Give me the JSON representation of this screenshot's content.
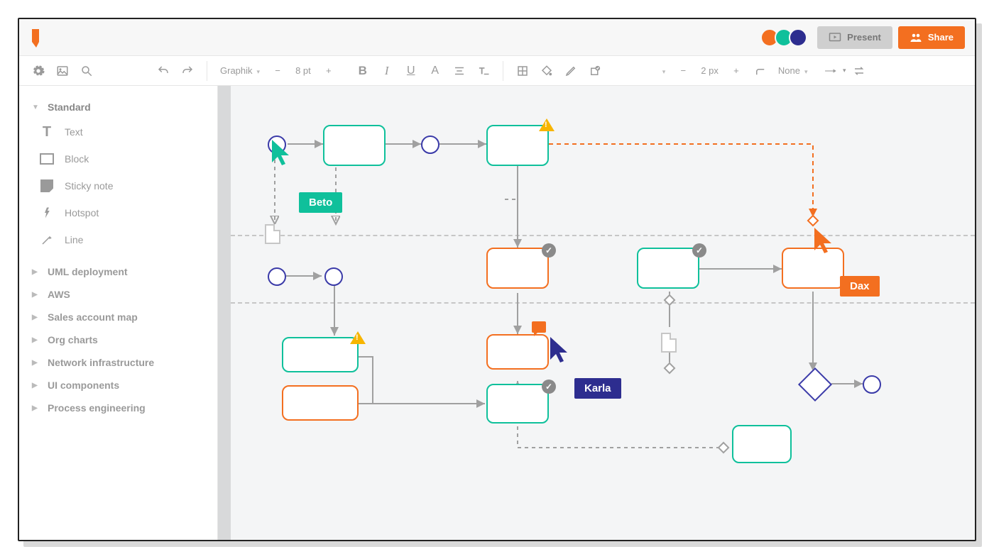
{
  "header": {
    "present_label": "Present",
    "share_label": "Share",
    "presence_colors": [
      "#f36f20",
      "#0fc09b",
      "#2d2d8f"
    ]
  },
  "toolbar": {
    "font_family": "Graphik",
    "font_size": "8 pt",
    "stroke_width": "2 px",
    "line_style": "None"
  },
  "sidebar": {
    "groups": [
      {
        "label": "Standard",
        "expanded": true,
        "items": [
          {
            "label": "Text",
            "icon": "text"
          },
          {
            "label": "Block",
            "icon": "block"
          },
          {
            "label": "Sticky note",
            "icon": "sticky"
          },
          {
            "label": "Hotspot",
            "icon": "hotspot"
          },
          {
            "label": "Line",
            "icon": "line"
          }
        ]
      },
      {
        "label": "UML deployment",
        "expanded": false
      },
      {
        "label": "AWS",
        "expanded": false
      },
      {
        "label": "Sales account map",
        "expanded": false
      },
      {
        "label": "Org charts",
        "expanded": false
      },
      {
        "label": "Network infrastructure",
        "expanded": false
      },
      {
        "label": "UI components",
        "expanded": false
      },
      {
        "label": "Process engineering",
        "expanded": false
      }
    ]
  },
  "collaborators": {
    "beto": "Beto",
    "karla": "Karla",
    "dax": "Dax"
  }
}
